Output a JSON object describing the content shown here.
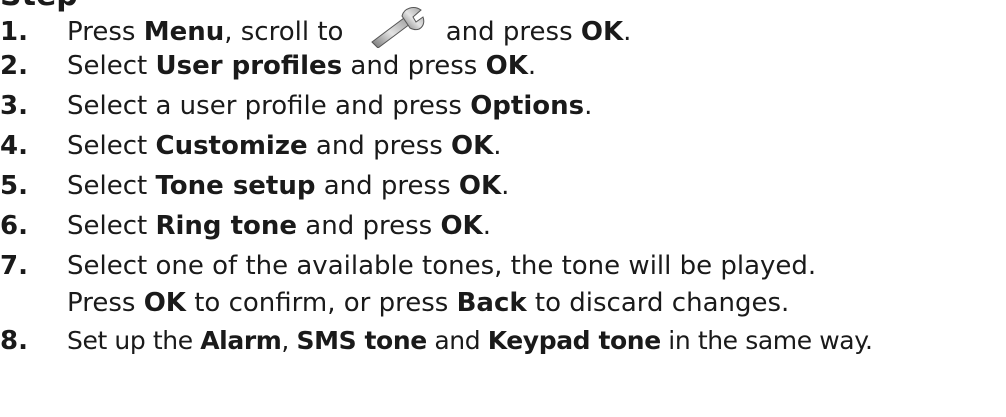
{
  "heading_fragment": "Step",
  "steps": [
    {
      "number": "1.",
      "parts": [
        "Press ",
        "Menu",
        ", scroll to ",
        "and press ",
        "OK",
        "."
      ],
      "icon": "wrench-icon"
    },
    {
      "number": "2.",
      "parts": [
        "Select ",
        "User profiles",
        " and press ",
        "OK",
        "."
      ]
    },
    {
      "number": "3.",
      "parts": [
        "Select a user profile and press ",
        "Options",
        "."
      ]
    },
    {
      "number": "4.",
      "parts": [
        "Select ",
        "Customize",
        " and press ",
        "OK",
        "."
      ]
    },
    {
      "number": "5.",
      "parts": [
        "Select ",
        "Tone setup",
        " and press ",
        "OK",
        "."
      ]
    },
    {
      "number": "6.",
      "parts": [
        "Select ",
        "Ring tone",
        " and press ",
        "OK",
        "."
      ]
    },
    {
      "number": "7.",
      "parts": [
        "Select one of the available tones, the tone will be played.",
        "Press ",
        "OK",
        " to confirm, or press ",
        "Back",
        " to discard changes."
      ]
    },
    {
      "number": "8.",
      "parts": [
        "Set up the ",
        "Alarm",
        ", ",
        "SMS tone",
        " and ",
        "Keypad tone",
        " in the same way."
      ]
    }
  ]
}
